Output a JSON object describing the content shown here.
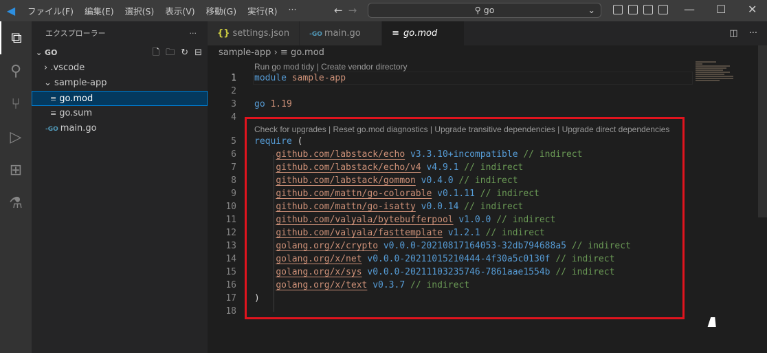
{
  "titlebar": {
    "menu": [
      "ファイル(F)",
      "編集(E)",
      "選択(S)",
      "表示(V)",
      "移動(G)",
      "実行(R)",
      "···"
    ],
    "search": "go"
  },
  "sidebar": {
    "title": "エクスプローラー",
    "more": "···",
    "root": "GO",
    "items": [
      {
        "label": ".vscode",
        "type": "folder-collapsed"
      },
      {
        "label": "sample-app",
        "type": "folder-open"
      },
      {
        "label": "go.mod",
        "type": "file",
        "selected": true
      },
      {
        "label": "go.sum",
        "type": "file"
      },
      {
        "label": "main.go",
        "type": "go"
      }
    ]
  },
  "tabs": [
    {
      "label": "settings.json",
      "icon": "json"
    },
    {
      "label": "main.go",
      "icon": "go"
    },
    {
      "label": "go.mod",
      "icon": "file",
      "active": true
    }
  ],
  "breadcrumb": [
    "sample-app",
    "go.mod"
  ],
  "editor": {
    "lens1": "Run go mod tidy | Create vendor directory",
    "lens2": "Check for upgrades | Reset go.mod diagnostics | Upgrade transitive dependencies | Upgrade direct dependencies",
    "module_kw": "module",
    "module_name": "sample-app",
    "go_kw": "go",
    "go_version": "1.19",
    "require_kw": "require",
    "open": "(",
    "close": ")",
    "deps": [
      {
        "path": "github.com/labstack/echo",
        "version": "v3.3.10+incompatible",
        "comment": "// indirect"
      },
      {
        "path": "github.com/labstack/echo/v4",
        "version": "v4.9.1",
        "comment": "// indirect"
      },
      {
        "path": "github.com/labstack/gommon",
        "version": "v0.4.0",
        "comment": "// indirect"
      },
      {
        "path": "github.com/mattn/go-colorable",
        "version": "v0.1.11",
        "comment": "// indirect"
      },
      {
        "path": "github.com/mattn/go-isatty",
        "version": "v0.0.14",
        "comment": "// indirect"
      },
      {
        "path": "github.com/valyala/bytebufferpool",
        "version": "v1.0.0",
        "comment": "// indirect"
      },
      {
        "path": "github.com/valyala/fasttemplate",
        "version": "v1.2.1",
        "comment": "// indirect"
      },
      {
        "path": "golang.org/x/crypto",
        "version": "v0.0.0-20210817164053-32db794688a5",
        "comment": "// indirect"
      },
      {
        "path": "golang.org/x/net",
        "version": "v0.0.0-20211015210444-4f30a5c0130f",
        "comment": "// indirect"
      },
      {
        "path": "golang.org/x/sys",
        "version": "v0.0.0-20211103235746-7861aae1554b",
        "comment": "// indirect"
      },
      {
        "path": "golang.org/x/text",
        "version": "v0.3.7",
        "comment": "// indirect"
      }
    ],
    "line_numbers": [
      "1",
      "2",
      "3",
      "4",
      "5",
      "6",
      "7",
      "8",
      "9",
      "10",
      "11",
      "12",
      "13",
      "14",
      "15",
      "16",
      "17",
      "18"
    ]
  },
  "colors": {
    "highlight_box": "#e0141e",
    "accent": "#007fd4"
  }
}
